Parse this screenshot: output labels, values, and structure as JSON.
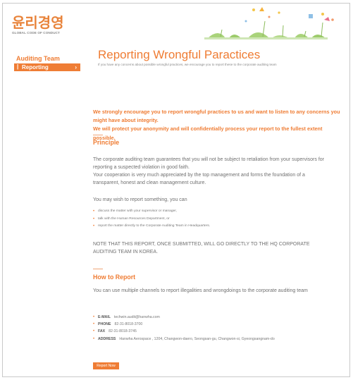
{
  "logo": {
    "korean": "윤리경영",
    "english": "GLOBAL CODE OF CONDUCT"
  },
  "sidebar": {
    "title": "Auditing Team",
    "items": [
      {
        "label": "Reporting"
      }
    ]
  },
  "page": {
    "title": "Reporting Wrongful Paractices",
    "subtitle": "If you have any concerns about possible wrongful practices, we encourage you to report these to the corporate auditing team"
  },
  "intro": [
    "We strongly encourage you to report wrongful practices to us and want to listen to any concerns you might have about integrity.",
    "We will protect your anonymity and will confidentially process your report to the fullest extent possible."
  ],
  "principle": {
    "heading": "Principle",
    "paragraphs": [
      "The corporate auditing team guarantees that you will not be subject to retaliation from your supervisors for reporting a suspected violation in good faith.",
      "Your cooperation is very much appreciated by the top management and forms the foundation of a transparent, honest and clean management culture."
    ],
    "may_wish": "You may wish to report something, you can",
    "options": [
      "discuss the matter with your supervisor or manager,",
      "talk with the Human Resources Department, or",
      "report the matter directly to the Corporate Auditing Team in Headquarters."
    ],
    "note": "NOTE THAT THIS REPORT, ONCE SUBMITTED, WILL GO DIRECTLY TO THE HQ CORPORATE AUDITING TEAM IN KOREA."
  },
  "how": {
    "heading": "How to Report",
    "text": "You can use multiple channels to report illegalities and wrongdoings to the corporate auditing team",
    "contacts": [
      {
        "label": "E-MAIL",
        "value": "techwin.audit@hanwha.com"
      },
      {
        "label": "PHONE",
        "value": "82-31-8018-3700"
      },
      {
        "label": "FAX",
        "value": "82-31-8018-3745"
      },
      {
        "label": "ADDRESS",
        "value": "Hanwha Aerospace , 1204, Changwon-daero, Seongsan-gu, Changwon-si, Gyeongsangnam-do"
      }
    ],
    "button": "Report Now"
  },
  "colors": {
    "accent": "#ef7c33",
    "text": "#707070"
  }
}
